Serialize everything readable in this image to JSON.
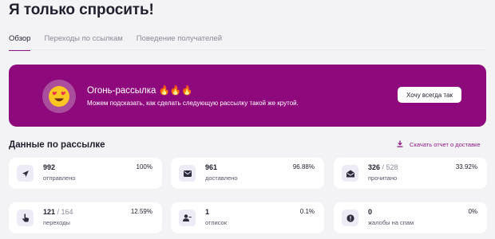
{
  "page_title": "Я только спросить!",
  "tabs": [
    {
      "label": "Обзор",
      "active": true
    },
    {
      "label": "Переходы по ссылкам",
      "active": false
    },
    {
      "label": "Поведение получателей",
      "active": false
    }
  ],
  "promo": {
    "title": "Огонь-рассылка 🔥🔥🔥",
    "text": "Можем подсказать, как сделать следующую рассылку такой же крутой.",
    "button": "Хочу всегда так",
    "avatar_icon": "heart-eyes-emoji-icon",
    "background_color": "#8e0a7c"
  },
  "stats_section": {
    "title": "Данные по рассылке",
    "download_label": "Скачать отчет о доставке"
  },
  "stats": [
    {
      "icon": "send-icon",
      "value": "992",
      "total": "",
      "label": "отправлено",
      "percent": "100%"
    },
    {
      "icon": "inbox-icon",
      "value": "961",
      "total": "",
      "label": "доставлено",
      "percent": "96.88%"
    },
    {
      "icon": "open-envelope-icon",
      "value": "326",
      "total": " / 528",
      "label": "прочитано",
      "percent": "33.92%"
    },
    {
      "icon": "pointer-hand-icon",
      "value": "121",
      "total": " / 164",
      "label": "переходы",
      "percent": "12.59%"
    },
    {
      "icon": "user-remove-icon",
      "value": "1",
      "total": "",
      "label": "отписок",
      "percent": "0.1%"
    },
    {
      "icon": "alert-circle-icon",
      "value": "0",
      "total": "",
      "label": "жалобы на спам",
      "percent": "0%"
    }
  ],
  "accent_color": "#8e1b82"
}
